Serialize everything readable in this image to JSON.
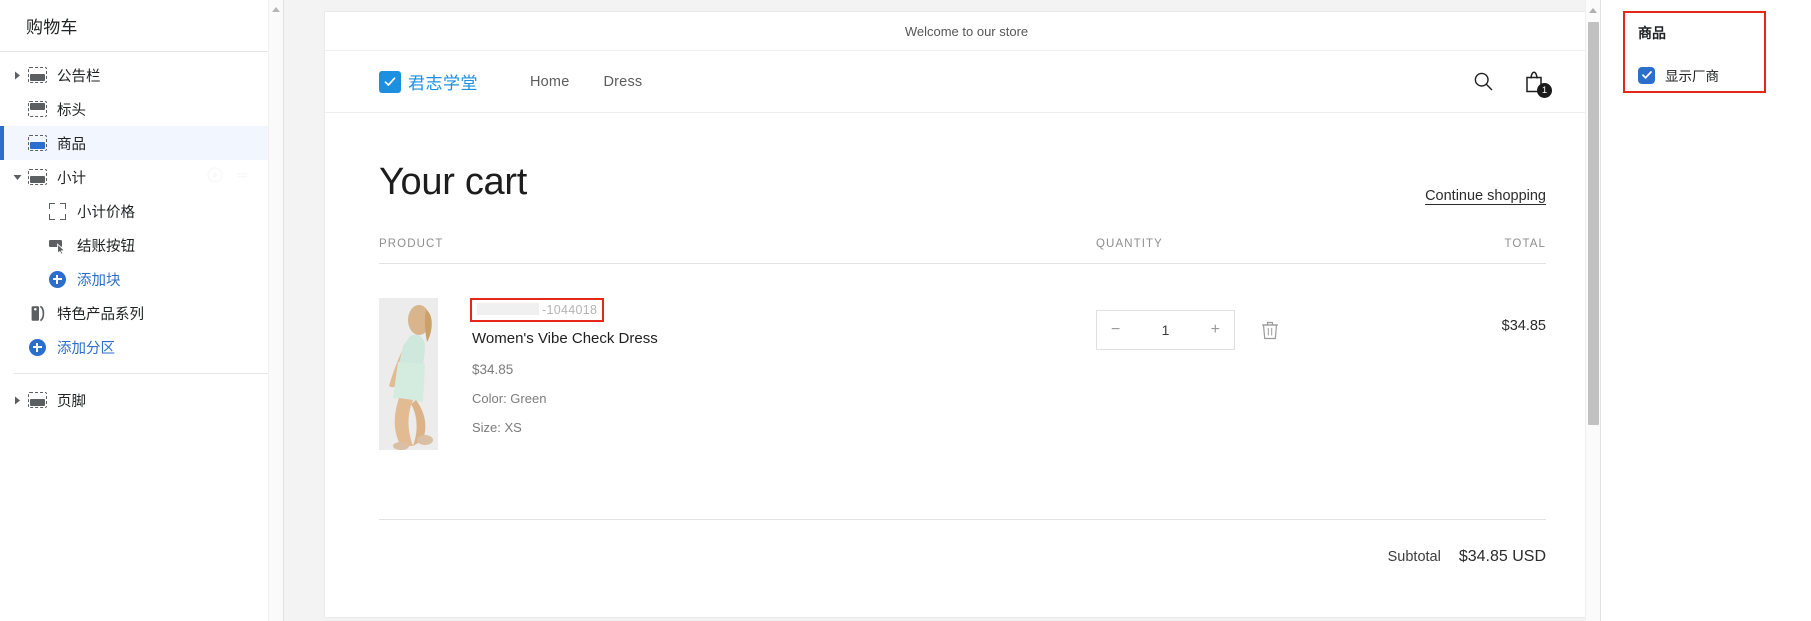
{
  "sidebar": {
    "title": "购物车",
    "items": [
      {
        "label": "公告栏",
        "icon": "block-icon",
        "caret": "right",
        "indent": 0,
        "selected": false,
        "link": false
      },
      {
        "label": "标头",
        "icon": "block-icon",
        "caret": "none",
        "indent": 0,
        "selected": false,
        "link": false
      },
      {
        "label": "商品",
        "icon": "block-icon-active",
        "caret": "none",
        "indent": 0,
        "selected": true,
        "link": false
      },
      {
        "label": "小计",
        "icon": "block-icon",
        "caret": "down",
        "indent": 0,
        "selected": false,
        "link": false
      },
      {
        "label": "小计价格",
        "icon": "brackets-icon",
        "caret": "none",
        "indent": 1,
        "selected": false,
        "link": false
      },
      {
        "label": "结账按钮",
        "icon": "button-icon",
        "caret": "none",
        "indent": 1,
        "selected": false,
        "link": false
      },
      {
        "label": "添加块",
        "icon": "plus-circle-icon",
        "caret": "none",
        "indent": 1,
        "selected": false,
        "link": true
      },
      {
        "label": "特色产品系列",
        "icon": "tag-icon",
        "caret": "none",
        "indent": 0,
        "selected": false,
        "link": false
      },
      {
        "label": "添加分区",
        "icon": "plus-circle-icon",
        "caret": "none",
        "indent": 0,
        "selected": false,
        "link": true
      },
      {
        "label": "页脚",
        "icon": "block-icon",
        "caret": "right",
        "indent": 0,
        "selected": false,
        "link": false
      }
    ],
    "separator_after_index": 8
  },
  "preview": {
    "announcement": "Welcome to our store",
    "store": {
      "logo_text": "君志学堂",
      "logo_icon": "checkmark-square-icon",
      "nav": [
        "Home",
        "Dress"
      ],
      "search_icon": "search-icon",
      "cart_icon": "shopping-bag-icon",
      "cart_count": "1"
    },
    "cart": {
      "title": "Your cart",
      "continue_shopping": "Continue shopping",
      "columns": {
        "product": "PRODUCT",
        "quantity": "QUANTITY",
        "total": "TOTAL"
      },
      "items": [
        {
          "vendor_redacted": "",
          "vendor_suffix": "-1044018",
          "name": "Women's Vibe Check Dress",
          "price": "$34.85",
          "color": "Color: Green",
          "size": "Size: XS",
          "qty_minus": "−",
          "qty_value": "1",
          "qty_plus": "+",
          "remove_icon": "trash-icon",
          "line_total": "$34.85"
        }
      ],
      "subtotal_label": "Subtotal",
      "subtotal_value": "$34.85 USD"
    }
  },
  "right_panel": {
    "title": "商品",
    "checkbox_label": "显示厂商",
    "checkbox_checked": true
  },
  "colors": {
    "accent_blue": "#2c6ecb",
    "highlight_red": "#e8271b",
    "logo_blue": "#1d8fe0",
    "selected_row_bg": "#f1f6ff"
  }
}
